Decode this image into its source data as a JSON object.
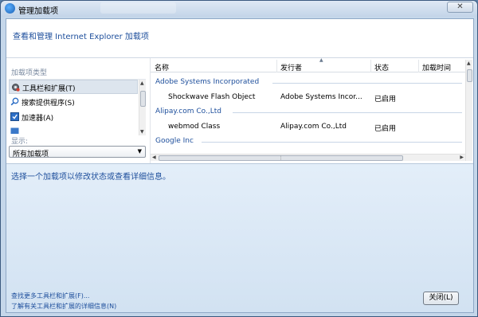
{
  "window": {
    "title": "管理加载项",
    "close_glyph": "✕"
  },
  "header": {
    "title": "查看和管理 Internet Explorer 加载项"
  },
  "left_pane": {
    "type_label": "加载项类型",
    "types": [
      {
        "label": "工具栏和扩展(T)",
        "icon": "gear-icon",
        "selected": true
      },
      {
        "label": "搜索提供程序(S)",
        "icon": "search-icon",
        "selected": false
      },
      {
        "label": "加速器(A)",
        "icon": "accelerator-icon",
        "selected": false
      }
    ],
    "show_label": "显示:",
    "show_select_value": "所有加载项"
  },
  "table": {
    "columns": [
      "名称",
      "发行者",
      "状态",
      "加载时间"
    ],
    "groups": [
      {
        "name": "Adobe Systems Incorporated",
        "rows": [
          {
            "name": "Shockwave Flash Object",
            "publisher": "Adobe Systems Incor...",
            "status": "已启用"
          }
        ]
      },
      {
        "name": "Alipay.com Co.,Ltd",
        "rows": [
          {
            "name": "webmod Class",
            "publisher": "Alipay.com Co.,Ltd",
            "status": "已启用"
          }
        ]
      },
      {
        "name": "Google Inc",
        "rows": []
      }
    ]
  },
  "details": {
    "message": "选择一个加载项以修改状态或查看详细信息。"
  },
  "footer": {
    "link1": "查找更多工具栏和扩展(F)...",
    "link2": "了解有关工具栏和扩展的详细信息(N)",
    "close_label": "关闭(L)"
  },
  "colors": {
    "link": "#1e4f9c",
    "details_bg": "#dbe8f6"
  }
}
